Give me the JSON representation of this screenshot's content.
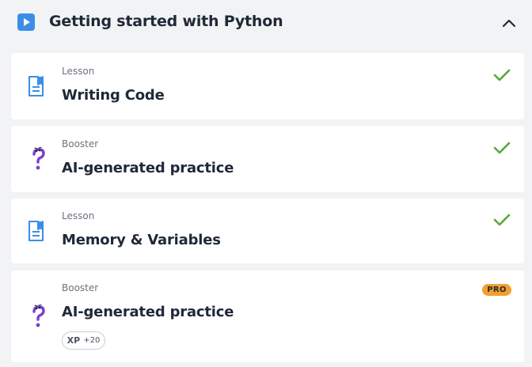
{
  "section": {
    "title": "Getting started with Python",
    "icon": "play-icon",
    "collapse_icon": "chevron-up-icon",
    "accent": "#3b8ee8"
  },
  "items": [
    {
      "type": "Lesson",
      "title": "Writing Code",
      "icon": "document-icon",
      "status": "completed"
    },
    {
      "type": "Booster",
      "title": "AI-generated practice",
      "icon": "question-mark-icon",
      "status": "completed"
    },
    {
      "type": "Lesson",
      "title": "Memory & Variables",
      "icon": "document-icon",
      "status": "completed"
    },
    {
      "type": "Booster",
      "title": "AI-generated practice",
      "icon": "question-mark-icon",
      "badge": "PRO",
      "xp_label": "XP",
      "xp_value": "+20"
    }
  ],
  "colors": {
    "check": "#5aa83c",
    "pro_badge": "#f0a030",
    "booster_icon": "#7b3fd0",
    "lesson_icon": "#3b8ee8"
  }
}
